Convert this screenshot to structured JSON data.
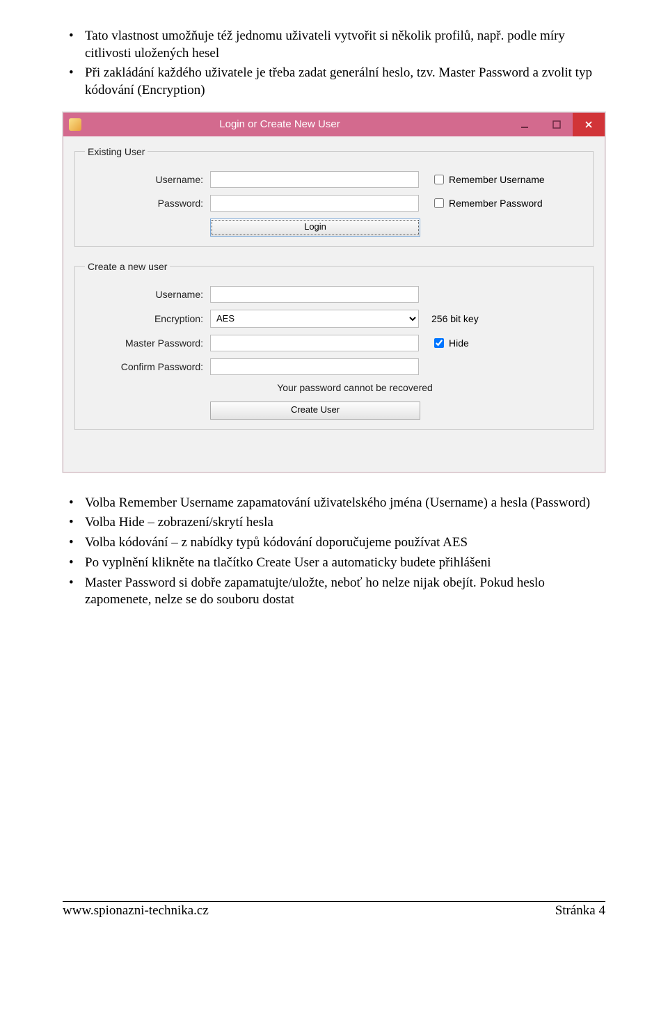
{
  "bullets_top": [
    "Tato vlastnost umožňuje též jednomu uživateli vytvořit si několik profilů, např. podle míry citlivosti uložených hesel",
    "Při zakládání každého uživatele je třeba zadat generální heslo, tzv. Master Password a zvolit typ kódování (Encryption)"
  ],
  "dialog": {
    "title": "Login or Create New User",
    "existing": {
      "legend": "Existing User",
      "username_label": "Username:",
      "password_label": "Password:",
      "remember_username": "Remember Username",
      "remember_password": "Remember Password",
      "login_button": "Login"
    },
    "create": {
      "legend": "Create a new user",
      "username_label": "Username:",
      "encryption_label": "Encryption:",
      "encryption_value": "AES",
      "encryption_keysize": "256 bit key",
      "master_password_label": "Master Password:",
      "hide_label": "Hide",
      "hide_checked": true,
      "confirm_password_label": "Confirm Password:",
      "info_text": "Your password cannot be recovered",
      "create_button": "Create User"
    }
  },
  "bullets_bottom": [
    "Volba Remember Username zapamatování uživatelského jména (Username) a hesla (Password)",
    "Volba Hide – zobrazení/skrytí hesla",
    "Volba kódování – z nabídky typů kódování doporučujeme používat AES",
    "Po vyplnění klikněte na tlačítko Create User a automaticky budete přihlášeni",
    "Master Password si dobře zapamatujte/uložte, neboť ho nelze nijak obejít. Pokud heslo zapomenete, nelze se do souboru dostat"
  ],
  "footer": {
    "url": "www.spionazni-technika.cz",
    "page": "Stránka 4"
  }
}
